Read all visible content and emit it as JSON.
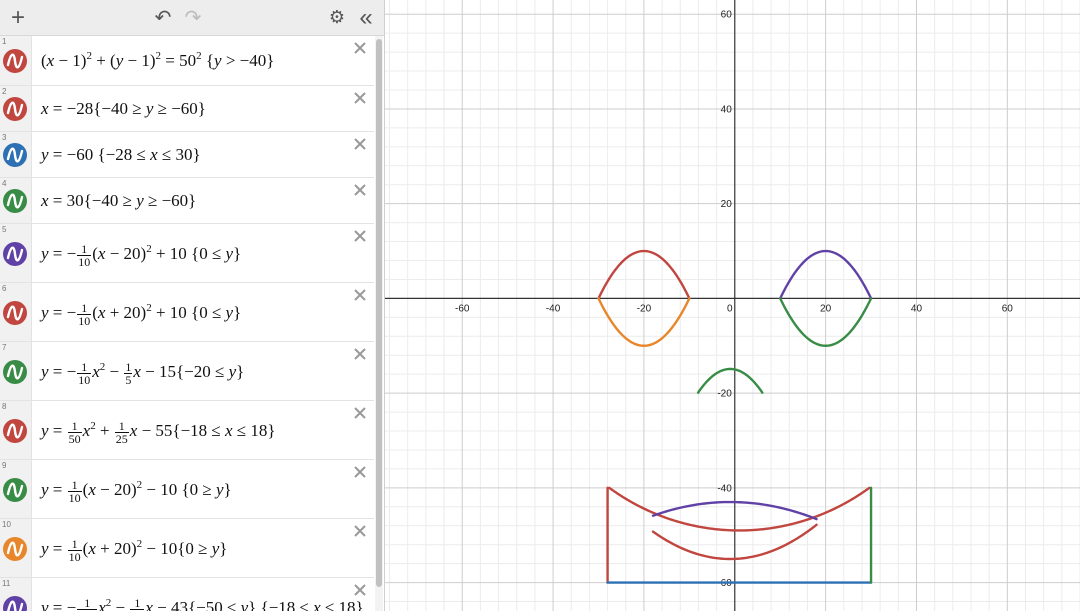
{
  "toolbar": {
    "add": "+",
    "undo": "↶",
    "redo": "↷",
    "settings": "⚙",
    "collapse": "«"
  },
  "colors": {
    "red": "#c0463f",
    "blue": "#2d70b3",
    "green": "#388c46",
    "purple": "#6042a6",
    "orange": "#e7862a"
  },
  "expressions": [
    {
      "index": "1",
      "color": "#c0463f",
      "h": 50
    },
    {
      "index": "2",
      "color": "#c0463f",
      "h": 46
    },
    {
      "index": "3",
      "color": "#2d70b3",
      "h": 46
    },
    {
      "index": "4",
      "color": "#388c46",
      "h": 46
    },
    {
      "index": "5",
      "color": "#6042a6",
      "h": 59
    },
    {
      "index": "6",
      "color": "#c0463f",
      "h": 59
    },
    {
      "index": "7",
      "color": "#388c46",
      "h": 59
    },
    {
      "index": "8",
      "color": "#c0463f",
      "h": 59
    },
    {
      "index": "9",
      "color": "#388c46",
      "h": 59
    },
    {
      "index": "10",
      "color": "#e7862a",
      "h": 59
    },
    {
      "index": "11",
      "color": "#6042a6",
      "h": 60
    }
  ],
  "graph": {
    "xrange": [
      -77,
      76
    ],
    "yrange": [
      -66,
      63
    ],
    "ticks_x": [
      "-60",
      "-40",
      "-20",
      "0",
      "20",
      "40",
      "60"
    ],
    "ticks_y": [
      "60",
      "40",
      "20",
      "-20",
      "-40",
      "-60"
    ]
  }
}
